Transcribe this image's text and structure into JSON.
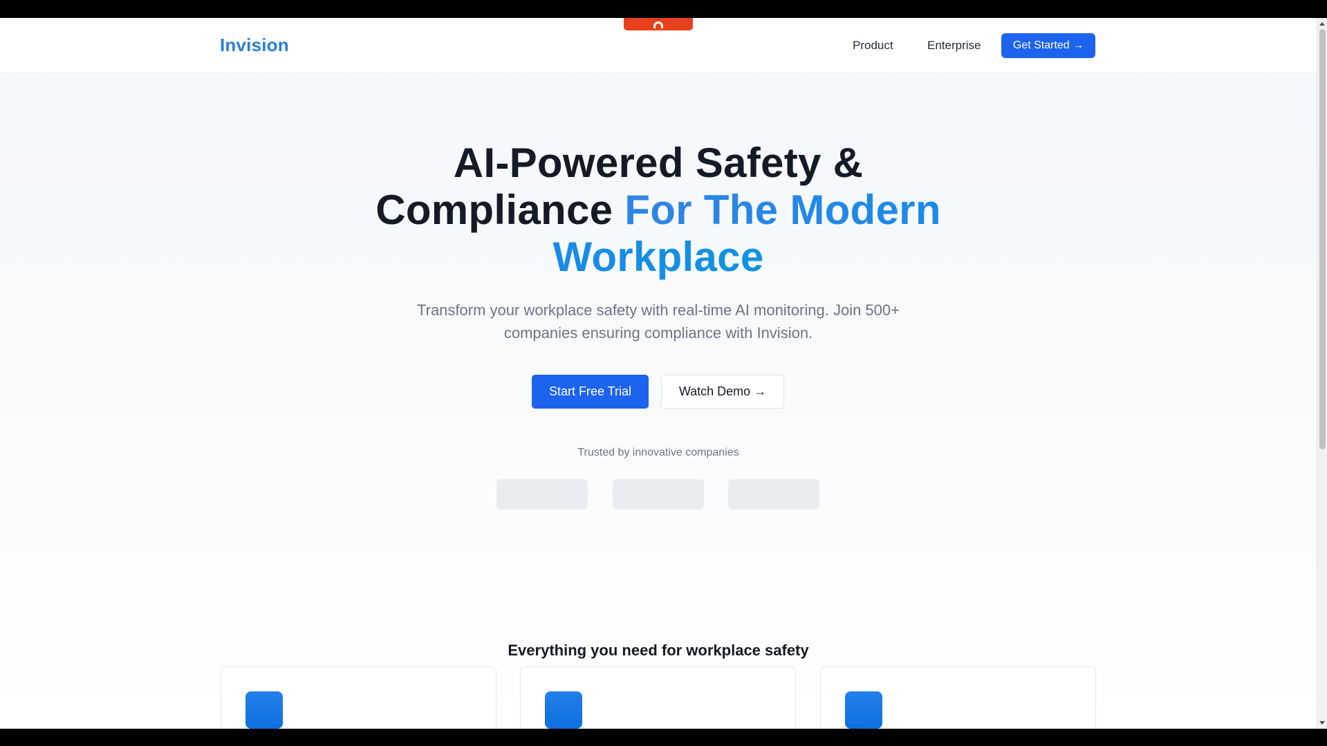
{
  "header": {
    "logo": "Invision",
    "nav": {
      "product": "Product",
      "enterprise": "Enterprise"
    },
    "cta": "Get Started →"
  },
  "hero": {
    "title_line1": "AI-Powered Safety &",
    "title_part2": "Compliance",
    "title_accent": "For The Modern Workplace",
    "subtitle": "Transform your workplace safety with real-time AI monitoring. Join 500+ companies ensuring compliance with Invision.",
    "primary_button": "Start Free Trial",
    "secondary_button": "Watch Demo →",
    "trusted_label": "Trusted by innovative companies"
  },
  "features": {
    "title": "Everything you need for workplace safety"
  },
  "colors": {
    "brand": "#2a7fd4",
    "primary_button": "#1d63ed",
    "recording_tab": "#e8401c"
  }
}
